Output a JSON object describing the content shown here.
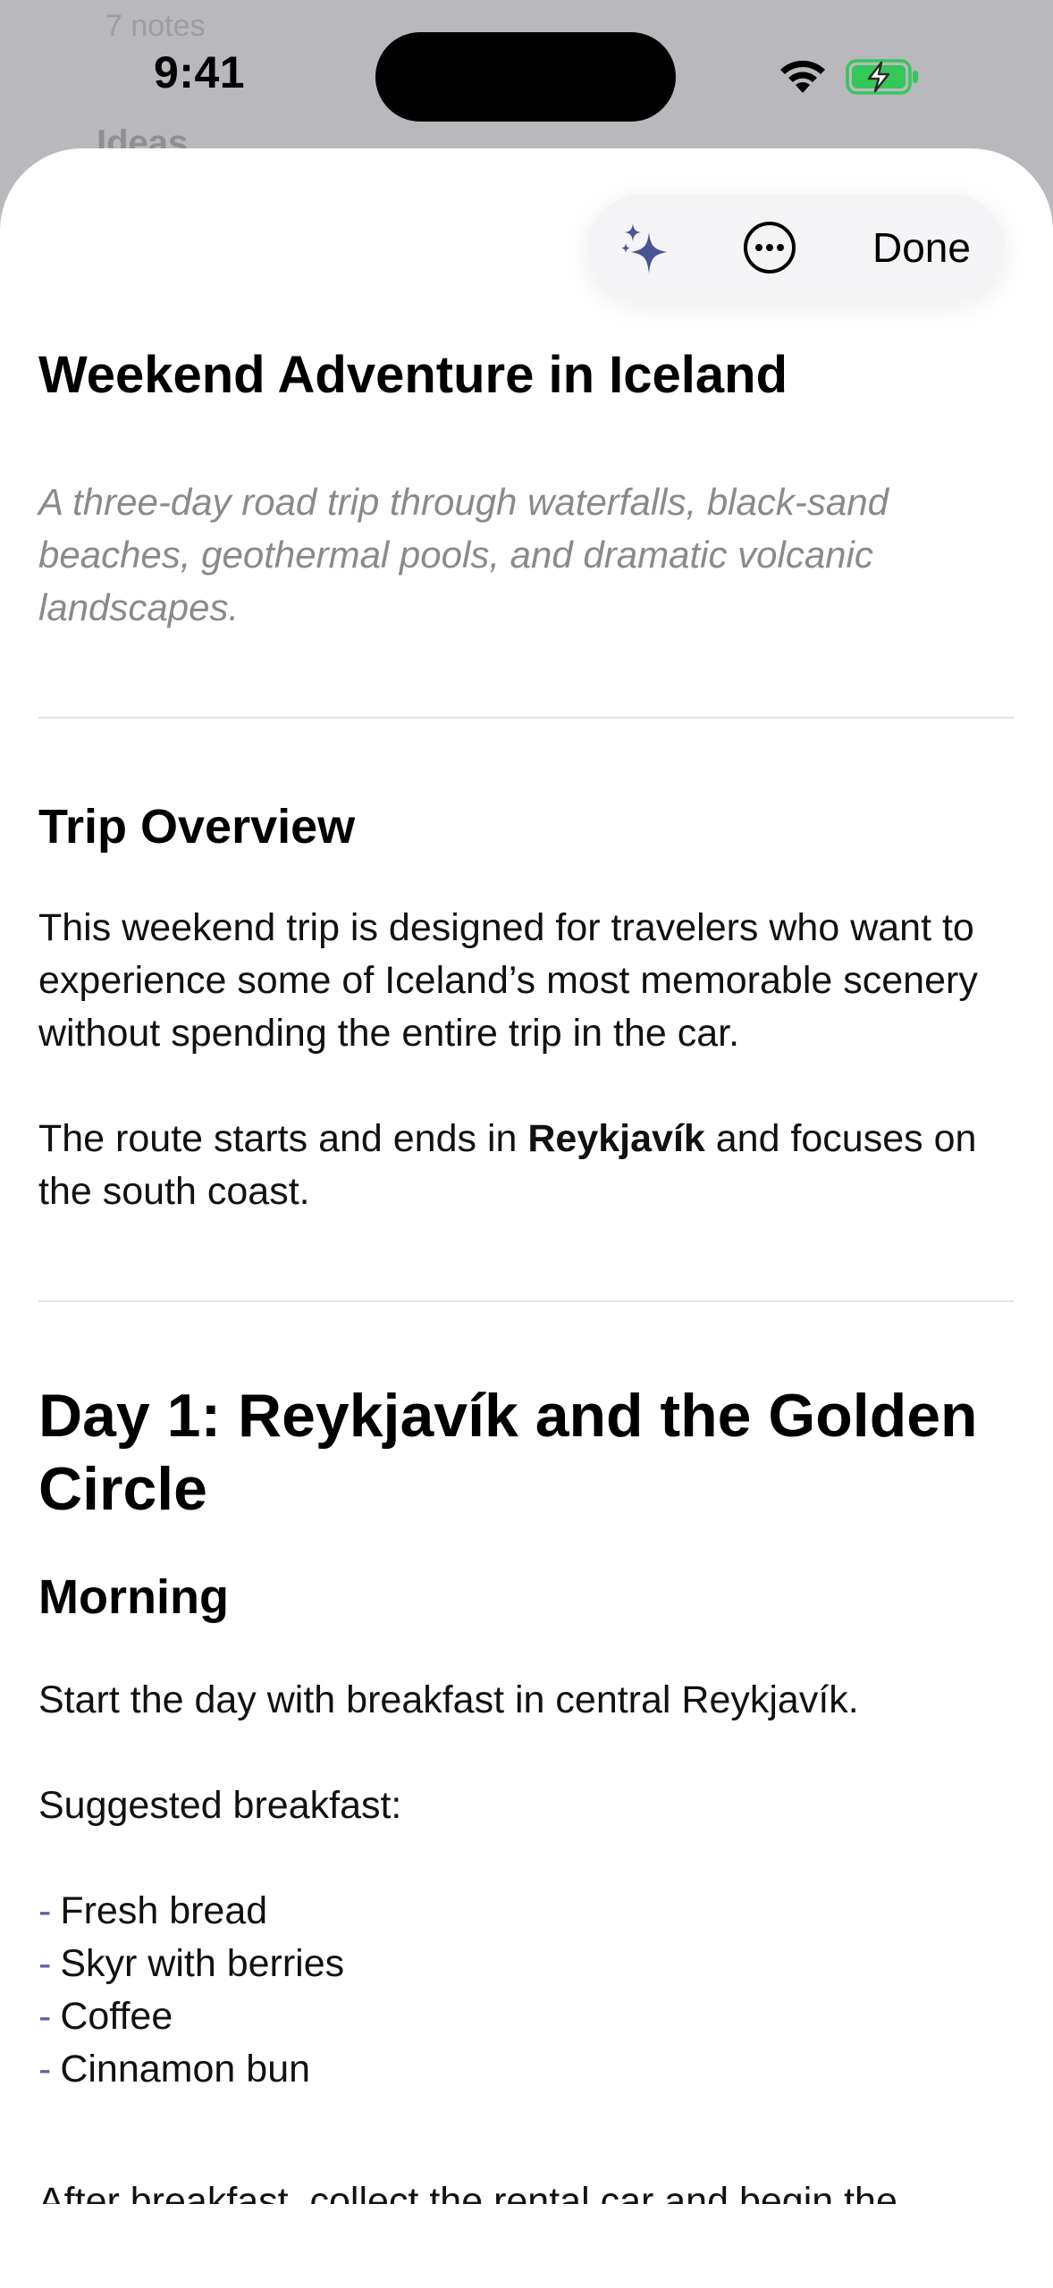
{
  "background": {
    "notes_count": "7 notes",
    "section": "Ideas"
  },
  "status_bar": {
    "time": "9:41"
  },
  "toolbar": {
    "ai_icon": "sparkle-icon",
    "more_icon": "ellipsis-circle-icon",
    "done_label": "Done",
    "accent": "#4a5396"
  },
  "note": {
    "title": "Weekend Adventure in Iceland",
    "subtitle": "A three-day road trip through waterfalls, black-sand beaches, geothermal pools, and dramatic volcanic landscapes.",
    "overview_heading": "Trip Overview",
    "overview_p1": "This weekend trip is designed for travelers who want to experience some of Iceland’s most memorable scenery without spending the entire trip in the car.",
    "overview_p2_before": "The route starts and ends in ",
    "overview_p2_bold": "Reykjavík",
    "overview_p2_after": " and focuses on the south coast.",
    "day1_heading": "Day 1: Reykjavík and the Golden Circle",
    "morning_heading": "Morning",
    "morning_p1": "Start the day with breakfast in central Reykjavík.",
    "breakfast_label": "Suggested breakfast:",
    "list_dash": "-",
    "breakfast_items": [
      "Fresh bread",
      "Skyr with berries",
      "Coffee",
      "Cinnamon bun"
    ],
    "cut_line": "After breakfast, collect the rental car and begin the"
  }
}
